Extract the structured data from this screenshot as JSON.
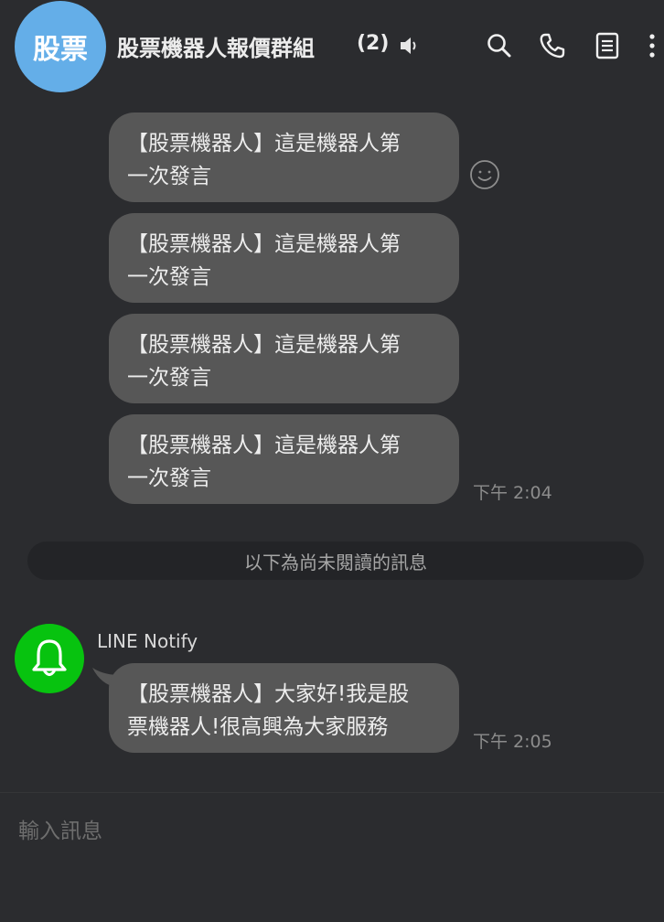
{
  "header": {
    "avatar_text": "股票",
    "title": "股票機器人報價群組",
    "member_count": "(2)",
    "icons": [
      "speaker-icon",
      "search-icon",
      "phone-icon",
      "notes-icon",
      "more-icon"
    ]
  },
  "messages": [
    {
      "text_line1": "【股票機器人】這是機器人第",
      "text_line2": "一次發言"
    },
    {
      "text_line1": "【股票機器人】這是機器人第",
      "text_line2": "一次發言"
    },
    {
      "text_line1": "【股票機器人】這是機器人第",
      "text_line2": "一次發言"
    },
    {
      "text_line1": "【股票機器人】這是機器人第",
      "text_line2": "一次發言",
      "time": "下午 2:04"
    }
  ],
  "unread_divider": "以下為尚未閱讀的訊息",
  "notify_message": {
    "sender": "LINE Notify",
    "text_line1": "【股票機器人】大家好!我是股",
    "text_line2": "票機器人!很高興為大家服務",
    "time": "下午 2:05"
  },
  "composer": {
    "placeholder": "輸入訊息"
  },
  "colors": {
    "background": "#2b2c2f",
    "bubble": "#575757",
    "avatar": "#64aee8",
    "notify_avatar": "#07c30f"
  }
}
